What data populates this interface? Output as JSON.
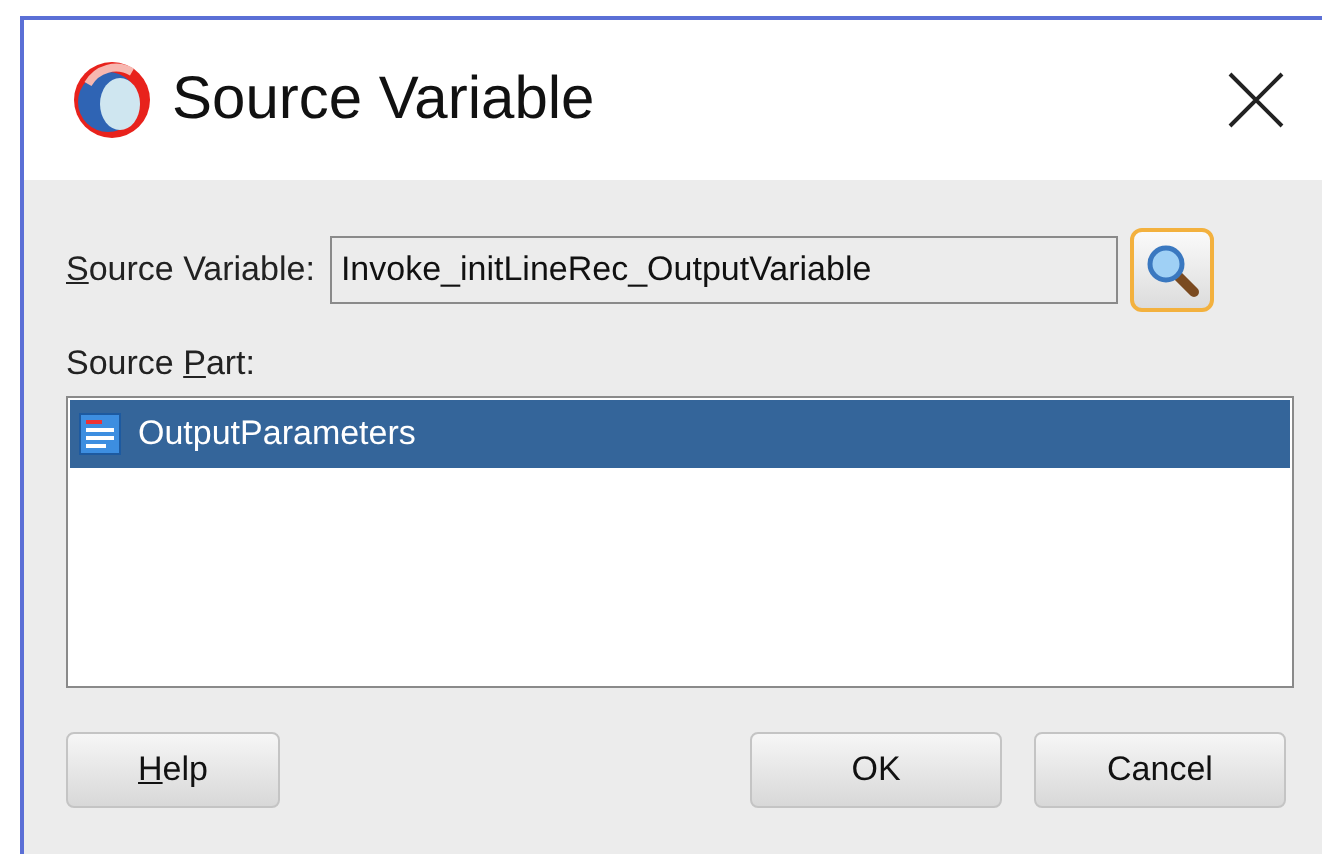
{
  "window": {
    "title": "Source Variable"
  },
  "source_variable": {
    "label": {
      "mnemonic": "S",
      "after": "ource Variable:"
    },
    "value": "Invoke_initLineRec_OutputVariable"
  },
  "source_part": {
    "label": {
      "before": "Source ",
      "mnemonic": "P",
      "after": "art:"
    },
    "items": [
      {
        "label": "OutputParameters",
        "selected": true
      }
    ]
  },
  "buttons": [
    {
      "label": {
        "mnemonic": "H",
        "after": "elp"
      },
      "kind": "left"
    },
    {
      "label": {
        "before": "OK"
      },
      "kind": "right"
    },
    {
      "label": {
        "before": "Cancel"
      },
      "kind": "right"
    }
  ]
}
